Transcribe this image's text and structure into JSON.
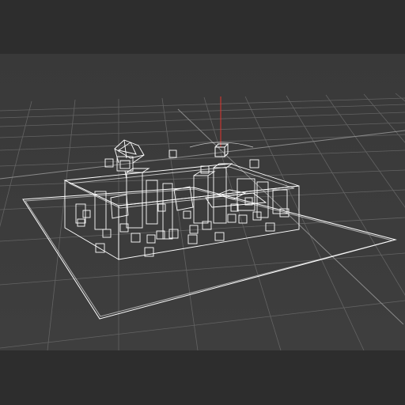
{
  "viewport": {
    "view": "perspective",
    "render_mode": "wireframe",
    "grid_visible": true
  },
  "colors": {
    "frame_bar": "#2d2d2d",
    "viewport_bg": "#3c3c3c",
    "grid_line": "#6a6a6a",
    "wire": "#ffffff",
    "z_axis": "#e2342d"
  },
  "scene": {
    "objects": [
      "ground-plane",
      "building-complex",
      "tree-model",
      "gizmo-cube",
      "cubes"
    ]
  }
}
